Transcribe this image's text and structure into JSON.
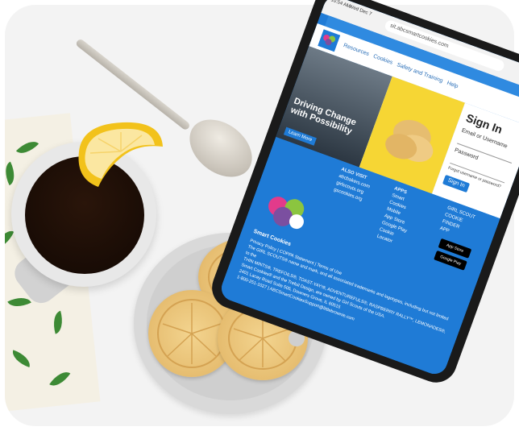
{
  "browser": {
    "time": "10:54 AM",
    "date": "Wed Dec 7",
    "url": "sit.abcsmartcookies.com"
  },
  "nav": {
    "links": [
      "Resources",
      "Cookies",
      "Safety and Training",
      "Help"
    ]
  },
  "signin": {
    "title": "Sign In",
    "email_label": "Email or Username",
    "password_label": "Password",
    "forgot_label": "Forgot username or password?",
    "button_label": "Sign In"
  },
  "hero": {
    "title": "Driving Change with Possibility",
    "learn_button": "Learn More"
  },
  "footer": {
    "also_visit_heading": "ALSO VISIT",
    "also_visit_items": [
      "abcbakers.com",
      "girlscouts.org",
      "gscookies.org"
    ],
    "apps_heading": "APPS",
    "apps_items": [
      "Smart",
      "Cookies",
      "Mobile",
      "App Store",
      "Google Play",
      "Cookie",
      "Locator"
    ],
    "finder_items": [
      "GIRL SCOUT",
      "COOKIE",
      "FINDER",
      "APP"
    ],
    "logo_text": "Smart Cookies",
    "legal_lines": [
      "Privacy Policy | COPPA Statement | Terms of Use",
      "The GIRL SCOUTS® name and mark, and all associated trademarks and logotypes, including but not limited to the",
      "THIN MINTS®, TREFOILS®, TOAST-YAY!®, ADVENTUREFULS®, RASPBERRY RALLY™, LEMONADES®,",
      "Smart Cookies® and the Trefoil Design, are owned by Girl Scouts of the USA.",
      "2401 Lacey Road Suite 505, Downers Grove, IL 60515",
      "1-800-251-1027 | ABCSmartCookiesSupport@littlebrownie.com"
    ],
    "app_store_label": "App Store",
    "google_play_label": "Google Play"
  }
}
